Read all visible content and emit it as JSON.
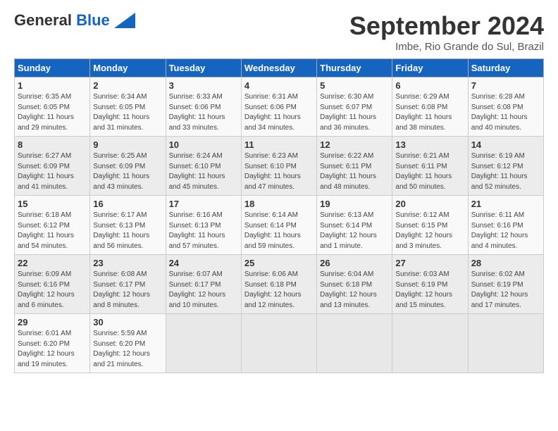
{
  "header": {
    "logo_line1": "General",
    "logo_line2": "Blue",
    "month": "September 2024",
    "location": "Imbe, Rio Grande do Sul, Brazil"
  },
  "days_of_week": [
    "Sunday",
    "Monday",
    "Tuesday",
    "Wednesday",
    "Thursday",
    "Friday",
    "Saturday"
  ],
  "weeks": [
    [
      {
        "day": "1",
        "info": "Sunrise: 6:35 AM\nSunset: 6:05 PM\nDaylight: 11 hours\nand 29 minutes."
      },
      {
        "day": "2",
        "info": "Sunrise: 6:34 AM\nSunset: 6:05 PM\nDaylight: 11 hours\nand 31 minutes."
      },
      {
        "day": "3",
        "info": "Sunrise: 6:33 AM\nSunset: 6:06 PM\nDaylight: 11 hours\nand 33 minutes."
      },
      {
        "day": "4",
        "info": "Sunrise: 6:31 AM\nSunset: 6:06 PM\nDaylight: 11 hours\nand 34 minutes."
      },
      {
        "day": "5",
        "info": "Sunrise: 6:30 AM\nSunset: 6:07 PM\nDaylight: 11 hours\nand 36 minutes."
      },
      {
        "day": "6",
        "info": "Sunrise: 6:29 AM\nSunset: 6:08 PM\nDaylight: 11 hours\nand 38 minutes."
      },
      {
        "day": "7",
        "info": "Sunrise: 6:28 AM\nSunset: 6:08 PM\nDaylight: 11 hours\nand 40 minutes."
      }
    ],
    [
      {
        "day": "8",
        "info": "Sunrise: 6:27 AM\nSunset: 6:09 PM\nDaylight: 11 hours\nand 41 minutes."
      },
      {
        "day": "9",
        "info": "Sunrise: 6:25 AM\nSunset: 6:09 PM\nDaylight: 11 hours\nand 43 minutes."
      },
      {
        "day": "10",
        "info": "Sunrise: 6:24 AM\nSunset: 6:10 PM\nDaylight: 11 hours\nand 45 minutes."
      },
      {
        "day": "11",
        "info": "Sunrise: 6:23 AM\nSunset: 6:10 PM\nDaylight: 11 hours\nand 47 minutes."
      },
      {
        "day": "12",
        "info": "Sunrise: 6:22 AM\nSunset: 6:11 PM\nDaylight: 11 hours\nand 48 minutes."
      },
      {
        "day": "13",
        "info": "Sunrise: 6:21 AM\nSunset: 6:11 PM\nDaylight: 11 hours\nand 50 minutes."
      },
      {
        "day": "14",
        "info": "Sunrise: 6:19 AM\nSunset: 6:12 PM\nDaylight: 11 hours\nand 52 minutes."
      }
    ],
    [
      {
        "day": "15",
        "info": "Sunrise: 6:18 AM\nSunset: 6:12 PM\nDaylight: 11 hours\nand 54 minutes."
      },
      {
        "day": "16",
        "info": "Sunrise: 6:17 AM\nSunset: 6:13 PM\nDaylight: 11 hours\nand 56 minutes."
      },
      {
        "day": "17",
        "info": "Sunrise: 6:16 AM\nSunset: 6:13 PM\nDaylight: 11 hours\nand 57 minutes."
      },
      {
        "day": "18",
        "info": "Sunrise: 6:14 AM\nSunset: 6:14 PM\nDaylight: 11 hours\nand 59 minutes."
      },
      {
        "day": "19",
        "info": "Sunrise: 6:13 AM\nSunset: 6:14 PM\nDaylight: 12 hours\nand 1 minute."
      },
      {
        "day": "20",
        "info": "Sunrise: 6:12 AM\nSunset: 6:15 PM\nDaylight: 12 hours\nand 3 minutes."
      },
      {
        "day": "21",
        "info": "Sunrise: 6:11 AM\nSunset: 6:16 PM\nDaylight: 12 hours\nand 4 minutes."
      }
    ],
    [
      {
        "day": "22",
        "info": "Sunrise: 6:09 AM\nSunset: 6:16 PM\nDaylight: 12 hours\nand 6 minutes."
      },
      {
        "day": "23",
        "info": "Sunrise: 6:08 AM\nSunset: 6:17 PM\nDaylight: 12 hours\nand 8 minutes."
      },
      {
        "day": "24",
        "info": "Sunrise: 6:07 AM\nSunset: 6:17 PM\nDaylight: 12 hours\nand 10 minutes."
      },
      {
        "day": "25",
        "info": "Sunrise: 6:06 AM\nSunset: 6:18 PM\nDaylight: 12 hours\nand 12 minutes."
      },
      {
        "day": "26",
        "info": "Sunrise: 6:04 AM\nSunset: 6:18 PM\nDaylight: 12 hours\nand 13 minutes."
      },
      {
        "day": "27",
        "info": "Sunrise: 6:03 AM\nSunset: 6:19 PM\nDaylight: 12 hours\nand 15 minutes."
      },
      {
        "day": "28",
        "info": "Sunrise: 6:02 AM\nSunset: 6:19 PM\nDaylight: 12 hours\nand 17 minutes."
      }
    ],
    [
      {
        "day": "29",
        "info": "Sunrise: 6:01 AM\nSunset: 6:20 PM\nDaylight: 12 hours\nand 19 minutes."
      },
      {
        "day": "30",
        "info": "Sunrise: 5:59 AM\nSunset: 6:20 PM\nDaylight: 12 hours\nand 21 minutes."
      },
      {
        "day": "",
        "info": ""
      },
      {
        "day": "",
        "info": ""
      },
      {
        "day": "",
        "info": ""
      },
      {
        "day": "",
        "info": ""
      },
      {
        "day": "",
        "info": ""
      }
    ]
  ]
}
